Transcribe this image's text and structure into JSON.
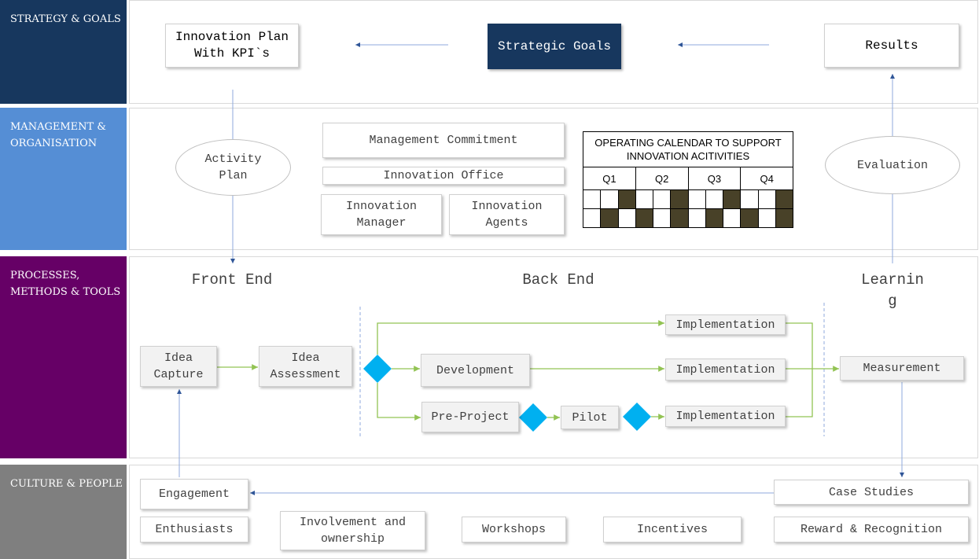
{
  "bands": [
    {
      "label": "STRATEGY & GOALS",
      "color": "#17375e"
    },
    {
      "label": "MANAGEMENT & ORGANISATION",
      "color": "#558ed5"
    },
    {
      "label": "PROCESSES, METHODS & TOOLS",
      "color": "#660066"
    },
    {
      "label": "CULTURE & PEOPLE",
      "color": "#7f7f7f"
    }
  ],
  "strategy": {
    "plan": "Innovation Plan With KPI`s",
    "goals": "Strategic Goals",
    "results": "Results"
  },
  "management": {
    "activity_plan": "Activity Plan",
    "commitment": "Management Commitment",
    "office": "Innovation Office",
    "manager": "Innovation Manager",
    "agents": "Innovation Agents",
    "evaluation": "Evaluation",
    "calendar": {
      "title": "OPERATING CALENDAR TO SUPPORT INNOVATION ACITIVITIES",
      "quarters": [
        "Q1",
        "Q2",
        "Q3",
        "Q4"
      ],
      "row1": [
        0,
        0,
        1,
        0,
        0,
        1,
        0,
        0,
        1,
        0,
        0,
        1
      ],
      "row2": [
        0,
        1,
        0,
        1,
        0,
        1,
        0,
        1,
        0,
        1,
        0,
        1
      ],
      "fill_color": "#484128"
    }
  },
  "processes": {
    "front_end": "Front End",
    "back_end": "Back End",
    "learning": "Learning",
    "idea_capture": "Idea Capture",
    "idea_assessment": "Idea Assessment",
    "development": "Development",
    "pre_project": "Pre-Project",
    "pilot": "Pilot",
    "implementation": "Implementation",
    "measurement": "Measurement",
    "decision_color": "#00b0f0",
    "flow_color": "#92c353"
  },
  "culture": {
    "engagement": "Engagement",
    "case_studies": "Case Studies",
    "enthusiasts": "Enthusiasts",
    "involvement": "Involvement and ownership",
    "workshops": "Workshops",
    "incentives": "Incentives",
    "reward": "Reward & Recognition"
  }
}
